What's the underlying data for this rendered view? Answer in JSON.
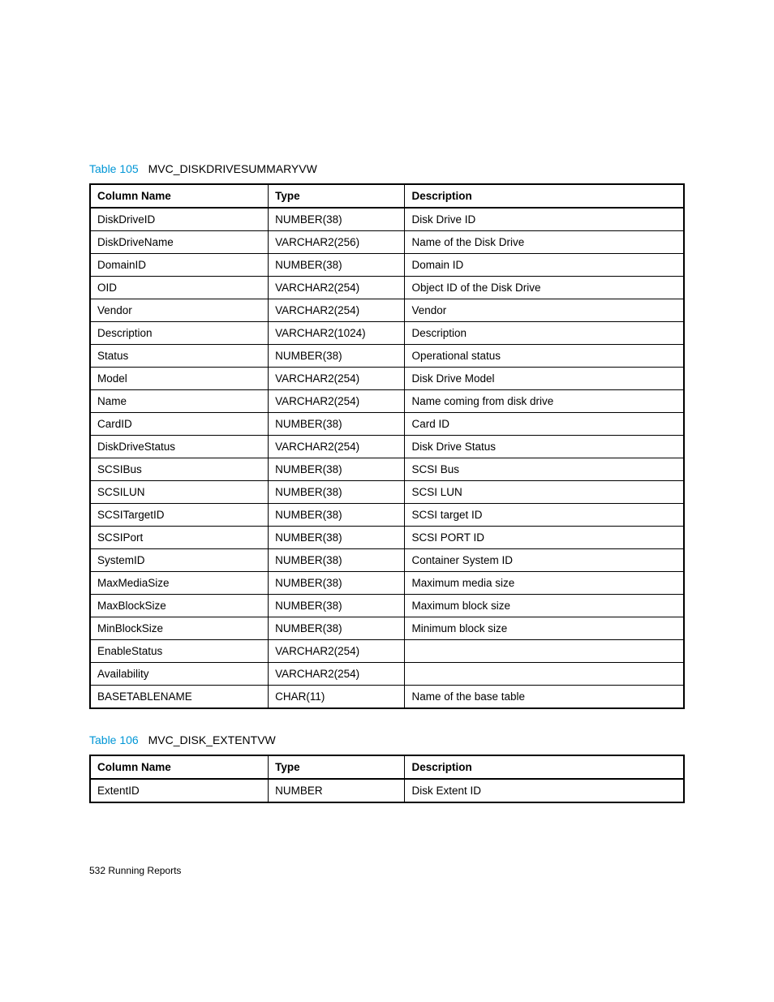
{
  "table105": {
    "label": "Table 105",
    "title": "MVC_DISKDRIVESUMMARYVW",
    "headers": [
      "Column Name",
      "Type",
      "Description"
    ],
    "rows": [
      [
        "DiskDriveID",
        "NUMBER(38)",
        "Disk Drive ID"
      ],
      [
        "DiskDriveName",
        "VARCHAR2(256)",
        "Name of the Disk Drive"
      ],
      [
        "DomainID",
        "NUMBER(38)",
        "Domain ID"
      ],
      [
        "OID",
        "VARCHAR2(254)",
        "Object ID of the Disk Drive"
      ],
      [
        "Vendor",
        "VARCHAR2(254)",
        "Vendor"
      ],
      [
        "Description",
        "VARCHAR2(1024)",
        "Description"
      ],
      [
        "Status",
        "NUMBER(38)",
        "Operational status"
      ],
      [
        "Model",
        "VARCHAR2(254)",
        "Disk Drive Model"
      ],
      [
        "Name",
        "VARCHAR2(254)",
        "Name coming from disk drive"
      ],
      [
        "CardID",
        "NUMBER(38)",
        "Card ID"
      ],
      [
        "DiskDriveStatus",
        "VARCHAR2(254)",
        "Disk Drive Status"
      ],
      [
        "SCSIBus",
        "NUMBER(38)",
        "SCSI Bus"
      ],
      [
        "SCSILUN",
        "NUMBER(38)",
        "SCSI LUN"
      ],
      [
        "SCSITargetID",
        "NUMBER(38)",
        "SCSI target ID"
      ],
      [
        "SCSIPort",
        "NUMBER(38)",
        "SCSI PORT ID"
      ],
      [
        "SystemID",
        "NUMBER(38)",
        "Container System ID"
      ],
      [
        "MaxMediaSize",
        "NUMBER(38)",
        "Maximum media size"
      ],
      [
        "MaxBlockSize",
        "NUMBER(38)",
        "Maximum block size"
      ],
      [
        "MinBlockSize",
        "NUMBER(38)",
        "Minimum block size"
      ],
      [
        "EnableStatus",
        "VARCHAR2(254)",
        ""
      ],
      [
        "Availability",
        "VARCHAR2(254)",
        ""
      ],
      [
        "BASETABLENAME",
        "CHAR(11)",
        "Name of the base table"
      ]
    ]
  },
  "table106": {
    "label": "Table 106",
    "title": "MVC_DISK_EXTENTVW",
    "headers": [
      "Column Name",
      "Type",
      "Description"
    ],
    "rows": [
      [
        "ExtentID",
        "NUMBER",
        "Disk Extent ID"
      ]
    ]
  },
  "footer": {
    "page": "532",
    "section": "Running Reports"
  }
}
